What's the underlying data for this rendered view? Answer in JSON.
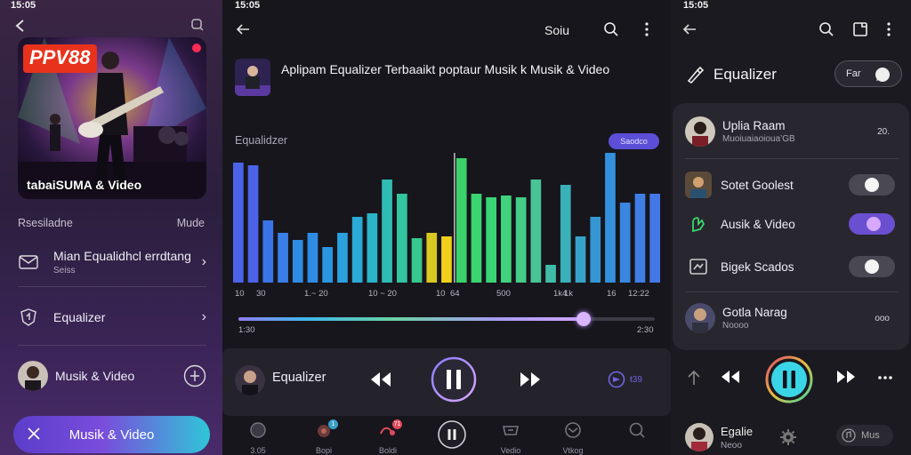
{
  "panel1": {
    "status_time": "15:05",
    "hero": {
      "brand": "PPV88",
      "caption": "tabaiSUMA & Video"
    },
    "section": {
      "left": "Rsesiladne",
      "right": "Mude"
    },
    "rows": [
      {
        "label": "Mian Equalidhcl errdtang",
        "sub": "Seiss"
      },
      {
        "label": "Equalizer"
      },
      {
        "label": "Musik & Video"
      }
    ],
    "bottom_bar": {
      "label": "Musik & Video"
    }
  },
  "panel2": {
    "status_time": "15:05",
    "sort_label": "Soiu",
    "track_title": "Aplipam Equalizer Terbaaikt poptaur Musik k Musik & Video",
    "eq_label": "Equalidzer",
    "pill_label": "Saodco",
    "ticks": [
      "10",
      "30",
      "1.~ 20",
      "10 ~ 20",
      "10",
      "64",
      "500",
      "1k4",
      "1k",
      "16",
      "12:22"
    ],
    "time_start": "1:30",
    "time_end": "2:30",
    "progress": 0.83,
    "now_playing": "Equalizer",
    "player_right": "ŧ39",
    "nav": [
      {
        "label": "3.05",
        "icon": "home-icon"
      },
      {
        "label": "Bopi",
        "icon": "music-icon",
        "badge": "1"
      },
      {
        "label": "Boldi",
        "icon": "playlist-icon",
        "badge": "71"
      },
      {
        "label": "",
        "icon": "pause-circle-icon"
      },
      {
        "label": "Vedio",
        "icon": "video-icon"
      },
      {
        "label": "Vtkog",
        "icon": "time-icon"
      },
      {
        "label": "",
        "icon": "search-icon"
      }
    ]
  },
  "panel3": {
    "status_time": "15:05",
    "title": "Equalizer",
    "toggle_pill": "Far",
    "rows": [
      {
        "label": "Uplia Raam",
        "sub": "Muoiuaiaoioua’GB",
        "trail": "20."
      },
      {
        "label": "Sotet Goolest",
        "switch": false
      },
      {
        "label": "Ausik & Video",
        "switch": true
      },
      {
        "label": "Bigek Scados",
        "switch": false
      },
      {
        "label": "Gotla Narag",
        "sub": "Noooo",
        "trail": "ooo"
      }
    ],
    "bottom": {
      "label": "Egalie",
      "sub": "Neoo",
      "right": "Mus"
    }
  },
  "colors": {
    "accent": "#6a4fd0",
    "accent_light": "#d8a8ff",
    "play_ring": "#3ad6e8",
    "eq_blue": "#3a8be8",
    "eq_green": "#2fd084",
    "eq_yellow": "#f2cf1a"
  }
}
